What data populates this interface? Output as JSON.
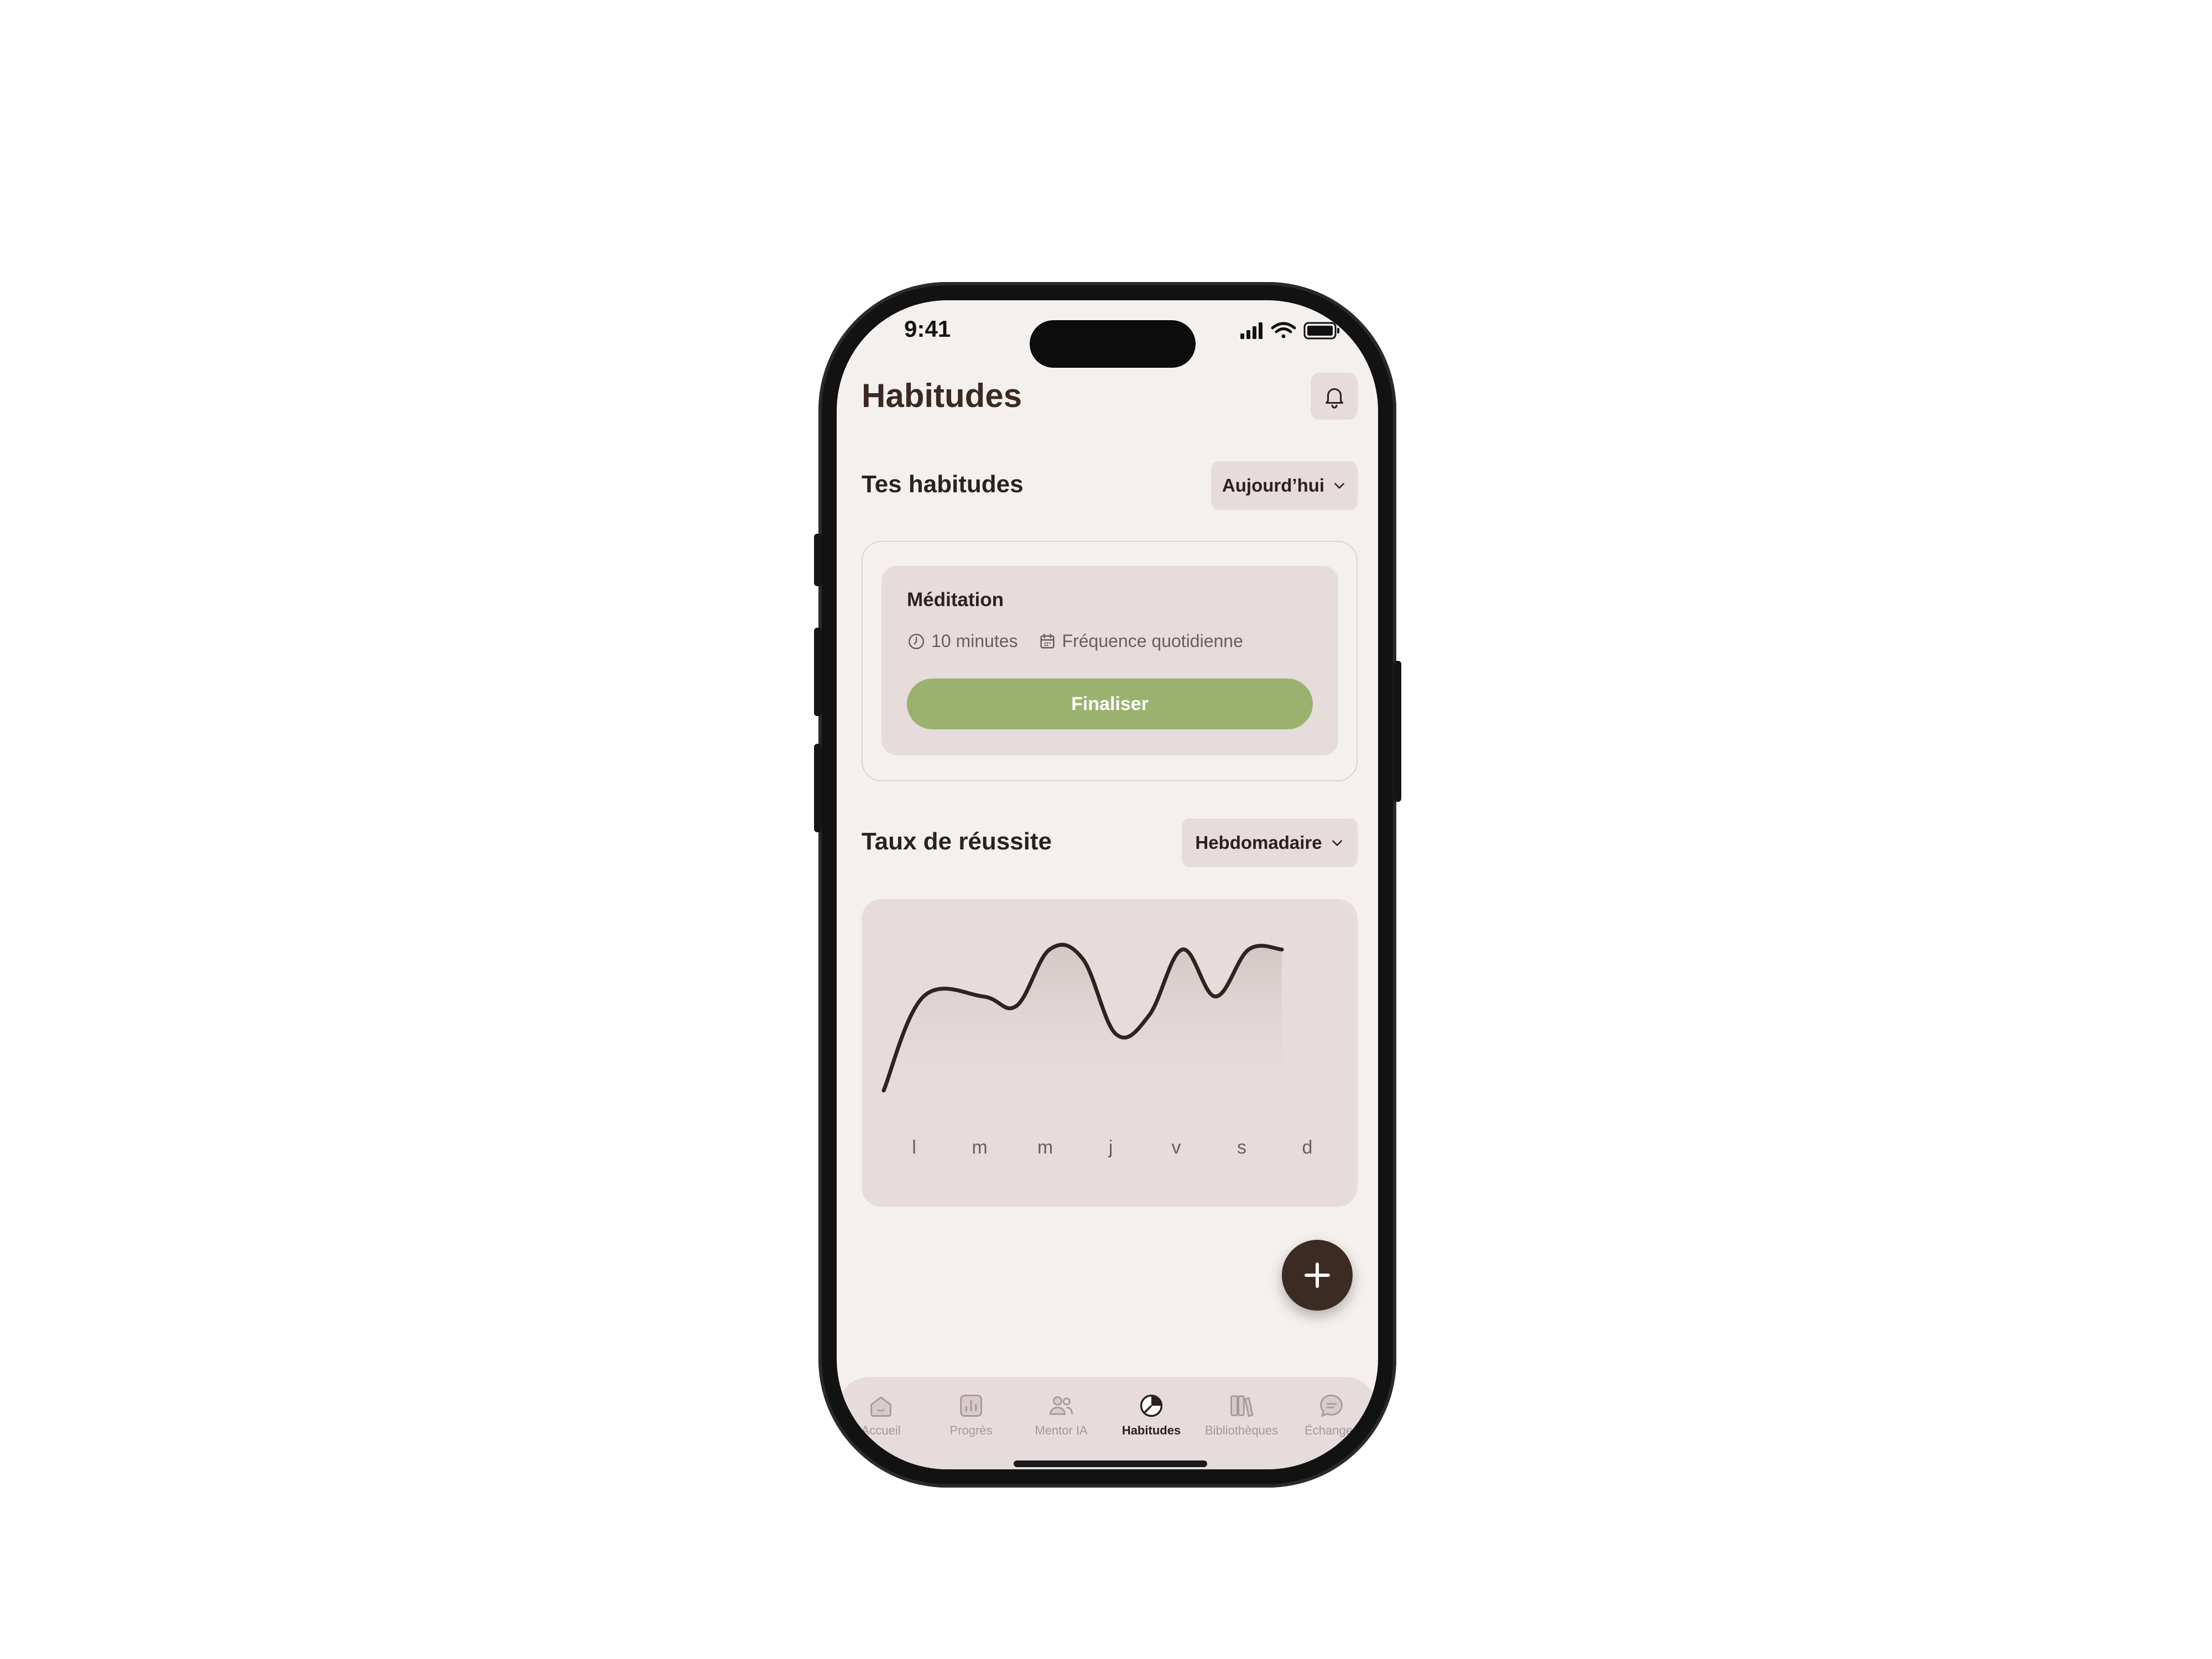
{
  "status_bar": {
    "time": "9:41"
  },
  "header": {
    "title": "Habitudes",
    "bell_icon": "bell-icon"
  },
  "habits_section": {
    "title": "Tes habitudes",
    "filter_label": "Aujourd’hui",
    "items": [
      {
        "name": "Méditation",
        "duration": "10 minutes",
        "frequency": "Fréquence quotidienne",
        "action_label": "Finaliser"
      }
    ]
  },
  "success_section": {
    "title": "Taux de réussite",
    "filter_label": "Hebdomadaire"
  },
  "chart_data": {
    "type": "line",
    "title": "",
    "xlabel": "",
    "ylabel": "",
    "categories": [
      "l",
      "m",
      "m",
      "j",
      "v",
      "s",
      "d"
    ],
    "x": [
      0,
      0.6,
      1.5,
      2,
      2.5,
      3,
      3.5,
      4,
      4.5,
      5,
      5.5,
      6
    ],
    "values": [
      10,
      60,
      60,
      55,
      85,
      80,
      40,
      50,
      85,
      60,
      85,
      85
    ],
    "ylim": [
      0,
      100
    ],
    "grid": false,
    "colors": {
      "line": "#2f231d",
      "fill_top": "#d3c8c5",
      "fill_bottom": "#e6dcdb"
    }
  },
  "fab": {
    "icon": "plus-icon"
  },
  "tab_bar": {
    "items": [
      {
        "label": "Accueil",
        "icon": "home-icon",
        "active": false
      },
      {
        "label": "Progrès",
        "icon": "bar-chart-icon",
        "active": false
      },
      {
        "label": "Mentor IA",
        "icon": "users-icon",
        "active": false
      },
      {
        "label": "Habitudes",
        "icon": "pie-chart-icon",
        "active": true
      },
      {
        "label": "Bibliothèques",
        "icon": "books-icon",
        "active": false
      },
      {
        "label": "Échanges",
        "icon": "chat-icon",
        "active": false
      }
    ]
  },
  "colors": {
    "accent_green": "#9bb26e",
    "brown": "#3b2b22",
    "surface": "#e6dcdb",
    "background": "#f4f0ee"
  }
}
